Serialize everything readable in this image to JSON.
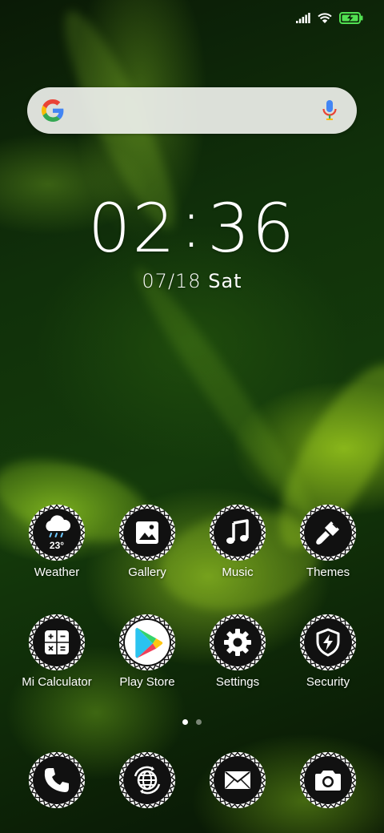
{
  "status_bar": {
    "signal_icon": "cellular-signal-icon",
    "wifi_icon": "wifi-icon",
    "battery_icon": "battery-charging-icon",
    "battery_color": "#52e052"
  },
  "search_widget": {
    "logo_icon": "google-g-logo",
    "mic_icon": "microphone-icon"
  },
  "clock": {
    "hours": "02",
    "separator": ":",
    "minutes": "36",
    "date": "07/18",
    "day_of_week": "Sat"
  },
  "apps_row_1": [
    {
      "label": "Weather",
      "icon": "weather-rain-cloud-icon",
      "temperature": "23°"
    },
    {
      "label": "Gallery",
      "icon": "gallery-picture-icon"
    },
    {
      "label": "Music",
      "icon": "music-note-icon"
    },
    {
      "label": "Themes",
      "icon": "paintbrush-icon"
    }
  ],
  "apps_row_2": [
    {
      "label": "Mi Calculator",
      "icon": "calculator-icon"
    },
    {
      "label": "Play Store",
      "icon": "play-store-icon"
    },
    {
      "label": "Settings",
      "icon": "gear-icon"
    },
    {
      "label": "Security",
      "icon": "shield-bolt-icon"
    }
  ],
  "page_indicator": {
    "pages": 2,
    "active_page": 1
  },
  "dock": [
    {
      "icon": "phone-icon"
    },
    {
      "icon": "browser-globe-icon"
    },
    {
      "icon": "messages-envelope-icon"
    },
    {
      "icon": "camera-icon"
    }
  ]
}
